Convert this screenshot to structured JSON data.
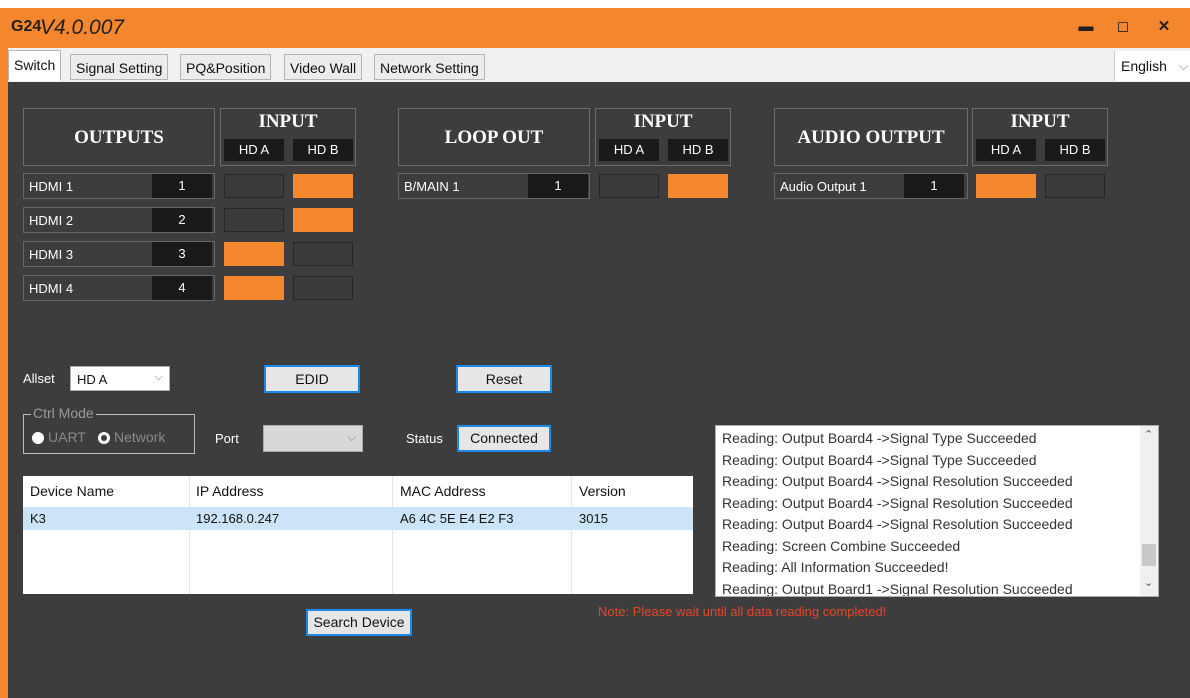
{
  "window": {
    "logo": "G24",
    "version": "V4.0.007",
    "minimize_glyph": "▬",
    "maximize_glyph": "◻",
    "close_glyph": "✕"
  },
  "tabs": [
    {
      "label": "Switch"
    },
    {
      "label": "Signal Setting"
    },
    {
      "label": "PQ&Position"
    },
    {
      "label": "Video Wall"
    },
    {
      "label": "Network Setting"
    }
  ],
  "language": {
    "value": "English"
  },
  "outputs": {
    "title": "OUTPUTS",
    "input_title": "INPUT",
    "inputs": [
      "HD A",
      "HD B"
    ],
    "rows": [
      {
        "label": "HDMI 1",
        "num": "1",
        "selected": "HD B"
      },
      {
        "label": "HDMI 2",
        "num": "2",
        "selected": "HD B"
      },
      {
        "label": "HDMI 3",
        "num": "3",
        "selected": "HD A"
      },
      {
        "label": "HDMI 4",
        "num": "4",
        "selected": "HD A"
      }
    ]
  },
  "loop_out": {
    "title": "LOOP OUT",
    "input_title": "INPUT",
    "inputs": [
      "HD A",
      "HD B"
    ],
    "rows": [
      {
        "label": "B/MAIN 1",
        "num": "1",
        "selected": "HD B"
      }
    ]
  },
  "audio_output": {
    "title": "AUDIO OUTPUT",
    "input_title": "INPUT",
    "inputs": [
      "HD A",
      "HD B"
    ],
    "rows": [
      {
        "label": "Audio Output 1",
        "num": "1",
        "selected": "HD A"
      }
    ]
  },
  "controls": {
    "allset_label": "Allset",
    "allset_value": "HD A",
    "edid_label": "EDID",
    "reset_label": "Reset",
    "ctrl_mode_label": "Ctrl Mode",
    "uart_label": "UART",
    "network_label": "Network",
    "port_label": "Port",
    "port_value": "",
    "status_label": "Status",
    "status_value": "Connected",
    "search_label": "Search Device"
  },
  "devices": {
    "columns": [
      "Device Name",
      "IP Address",
      "MAC Address",
      "Version"
    ],
    "rows": [
      {
        "name": "K3",
        "ip": "192.168.0.247",
        "mac": "A6 4C 5E E4 E2 F3",
        "version": "3015"
      }
    ]
  },
  "log": {
    "lines": [
      "Reading: Output Board4 ->Signal Type Succeeded",
      "Reading: Output Board4 ->Signal Type Succeeded",
      "Reading: Output Board4 ->Signal Resolution Succeeded",
      "Reading: Output Board4 ->Signal Resolution Succeeded",
      "Reading: Output Board4 ->Signal Resolution Succeeded",
      "Reading: Screen Combine Succeeded",
      "Reading: All Information Succeeded!",
      "Reading: Output Board1 ->Signal Resolution Succeeded"
    ]
  },
  "note": "Note: Please wait until all data reading completed!",
  "colors": {
    "accent": "#f4872d",
    "panel": "#3d3d3d",
    "note": "#e8452b",
    "selection": "#cce4f7"
  }
}
